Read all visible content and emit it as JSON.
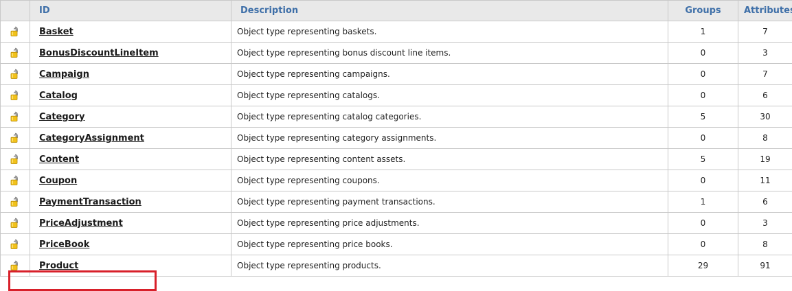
{
  "header": {
    "id": "ID",
    "description": "Description",
    "groups": "Groups",
    "attributes": "Attributes"
  },
  "icons": {
    "row_icon": "unlocked-padlock-icon"
  },
  "colors": {
    "header_text": "#3e6fa8",
    "header_bg": "#e9e9e9",
    "highlight": "#d8202a"
  },
  "rows": [
    {
      "id": "Basket",
      "description": "Object type representing baskets.",
      "groups": "1",
      "attributes": "7"
    },
    {
      "id": "BonusDiscountLineItem",
      "description": "Object type representing bonus discount line items.",
      "groups": "0",
      "attributes": "3"
    },
    {
      "id": "Campaign",
      "description": "Object type representing campaigns.",
      "groups": "0",
      "attributes": "7"
    },
    {
      "id": "Catalog",
      "description": "Object type representing catalogs.",
      "groups": "0",
      "attributes": "6"
    },
    {
      "id": "Category",
      "description": "Object type representing catalog categories.",
      "groups": "5",
      "attributes": "30"
    },
    {
      "id": "CategoryAssignment",
      "description": "Object type representing category assignments.",
      "groups": "0",
      "attributes": "8"
    },
    {
      "id": "Content",
      "description": "Object type representing content assets.",
      "groups": "5",
      "attributes": "19"
    },
    {
      "id": "Coupon",
      "description": "Object type representing coupons.",
      "groups": "0",
      "attributes": "11"
    },
    {
      "id": "PaymentTransaction",
      "description": "Object type representing payment transactions.",
      "groups": "1",
      "attributes": "6"
    },
    {
      "id": "PriceAdjustment",
      "description": "Object type representing price adjustments.",
      "groups": "0",
      "attributes": "3"
    },
    {
      "id": "PriceBook",
      "description": "Object type representing price books.",
      "groups": "0",
      "attributes": "8"
    },
    {
      "id": "Product",
      "description": "Object type representing products.",
      "groups": "29",
      "attributes": "91"
    }
  ]
}
